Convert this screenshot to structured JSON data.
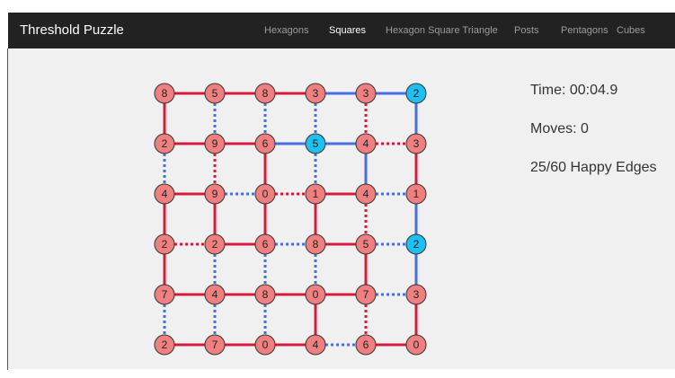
{
  "navbar": {
    "brand": "Threshold Puzzle",
    "items": [
      {
        "label": "Hexagons",
        "active": false
      },
      {
        "label": "Squares",
        "active": true
      },
      {
        "label": "Hexagon Square Triangle",
        "active": false
      },
      {
        "label": "Posts",
        "active": false
      },
      {
        "label": "Pentagons",
        "active": false
      },
      {
        "label": "Cubes",
        "active": false
      }
    ]
  },
  "stats": {
    "time": "Time: 00:04.9",
    "moves": "Moves: 0",
    "happy_edges": "25/60 Happy Edges"
  },
  "colors": {
    "red_node": "#f08080",
    "blue_node": "#1ec0f0",
    "red_edge": "#d81b3c",
    "blue_edge": "#4a6ee0",
    "node_stroke": "#333333"
  },
  "board": {
    "rows": 6,
    "cols": 6,
    "values": [
      [
        8,
        5,
        8,
        3,
        3,
        2
      ],
      [
        2,
        9,
        6,
        5,
        4,
        3
      ],
      [
        4,
        9,
        0,
        1,
        4,
        1
      ],
      [
        2,
        2,
        6,
        8,
        5,
        2
      ],
      [
        7,
        4,
        8,
        0,
        7,
        3
      ],
      [
        2,
        7,
        0,
        4,
        6,
        0
      ]
    ],
    "node_colors": [
      [
        "red",
        "red",
        "red",
        "red",
        "red",
        "blue"
      ],
      [
        "red",
        "red",
        "red",
        "blue",
        "red",
        "red"
      ],
      [
        "red",
        "red",
        "red",
        "red",
        "red",
        "red"
      ],
      [
        "red",
        "red",
        "red",
        "red",
        "red",
        "blue"
      ],
      [
        "red",
        "red",
        "red",
        "red",
        "red",
        "red"
      ],
      [
        "red",
        "red",
        "red",
        "red",
        "red",
        "red"
      ]
    ],
    "h_edges": [
      [
        {
          "c": "red",
          "s": "solid"
        },
        {
          "c": "red",
          "s": "solid"
        },
        {
          "c": "red",
          "s": "solid"
        },
        {
          "c": "blue",
          "s": "solid"
        },
        {
          "c": "blue",
          "s": "solid"
        }
      ],
      [
        {
          "c": "red",
          "s": "solid"
        },
        {
          "c": "red",
          "s": "solid"
        },
        {
          "c": "blue",
          "s": "solid"
        },
        {
          "c": "blue",
          "s": "solid"
        },
        {
          "c": "red",
          "s": "dotted"
        }
      ],
      [
        {
          "c": "red",
          "s": "solid"
        },
        {
          "c": "blue",
          "s": "dotted"
        },
        {
          "c": "red",
          "s": "dotted"
        },
        {
          "c": "red",
          "s": "solid"
        },
        {
          "c": "blue",
          "s": "dotted"
        }
      ],
      [
        {
          "c": "red",
          "s": "dotted"
        },
        {
          "c": "red",
          "s": "solid"
        },
        {
          "c": "blue",
          "s": "dotted"
        },
        {
          "c": "red",
          "s": "solid"
        },
        {
          "c": "blue",
          "s": "dotted"
        }
      ],
      [
        {
          "c": "red",
          "s": "solid"
        },
        {
          "c": "red",
          "s": "solid"
        },
        {
          "c": "red",
          "s": "solid"
        },
        {
          "c": "red",
          "s": "solid"
        },
        {
          "c": "blue",
          "s": "dotted"
        }
      ],
      [
        {
          "c": "red",
          "s": "solid"
        },
        {
          "c": "red",
          "s": "solid"
        },
        {
          "c": "red",
          "s": "solid"
        },
        {
          "c": "blue",
          "s": "dotted"
        },
        {
          "c": "red",
          "s": "solid"
        }
      ]
    ],
    "v_edges": [
      [
        {
          "c": "red",
          "s": "solid"
        },
        {
          "c": "blue",
          "s": "dotted"
        },
        {
          "c": "blue",
          "s": "dotted"
        },
        {
          "c": "blue",
          "s": "dotted"
        },
        {
          "c": "red",
          "s": "dotted"
        },
        {
          "c": "blue",
          "s": "solid"
        }
      ],
      [
        {
          "c": "blue",
          "s": "dotted"
        },
        {
          "c": "red",
          "s": "dotted"
        },
        {
          "c": "red",
          "s": "solid"
        },
        {
          "c": "blue",
          "s": "dotted"
        },
        {
          "c": "blue",
          "s": "solid"
        },
        {
          "c": "red",
          "s": "solid"
        }
      ],
      [
        {
          "c": "red",
          "s": "solid"
        },
        {
          "c": "red",
          "s": "solid"
        },
        {
          "c": "red",
          "s": "solid"
        },
        {
          "c": "red",
          "s": "solid"
        },
        {
          "c": "red",
          "s": "dotted"
        },
        {
          "c": "blue",
          "s": "solid"
        }
      ],
      [
        {
          "c": "red",
          "s": "solid"
        },
        {
          "c": "blue",
          "s": "dotted"
        },
        {
          "c": "blue",
          "s": "dotted"
        },
        {
          "c": "blue",
          "s": "dotted"
        },
        {
          "c": "red",
          "s": "solid"
        },
        {
          "c": "blue",
          "s": "solid"
        }
      ],
      [
        {
          "c": "blue",
          "s": "dotted"
        },
        {
          "c": "blue",
          "s": "dotted"
        },
        {
          "c": "blue",
          "s": "dotted"
        },
        {
          "c": "red",
          "s": "solid"
        },
        {
          "c": "red",
          "s": "dotted"
        },
        {
          "c": "red",
          "s": "solid"
        }
      ]
    ]
  }
}
